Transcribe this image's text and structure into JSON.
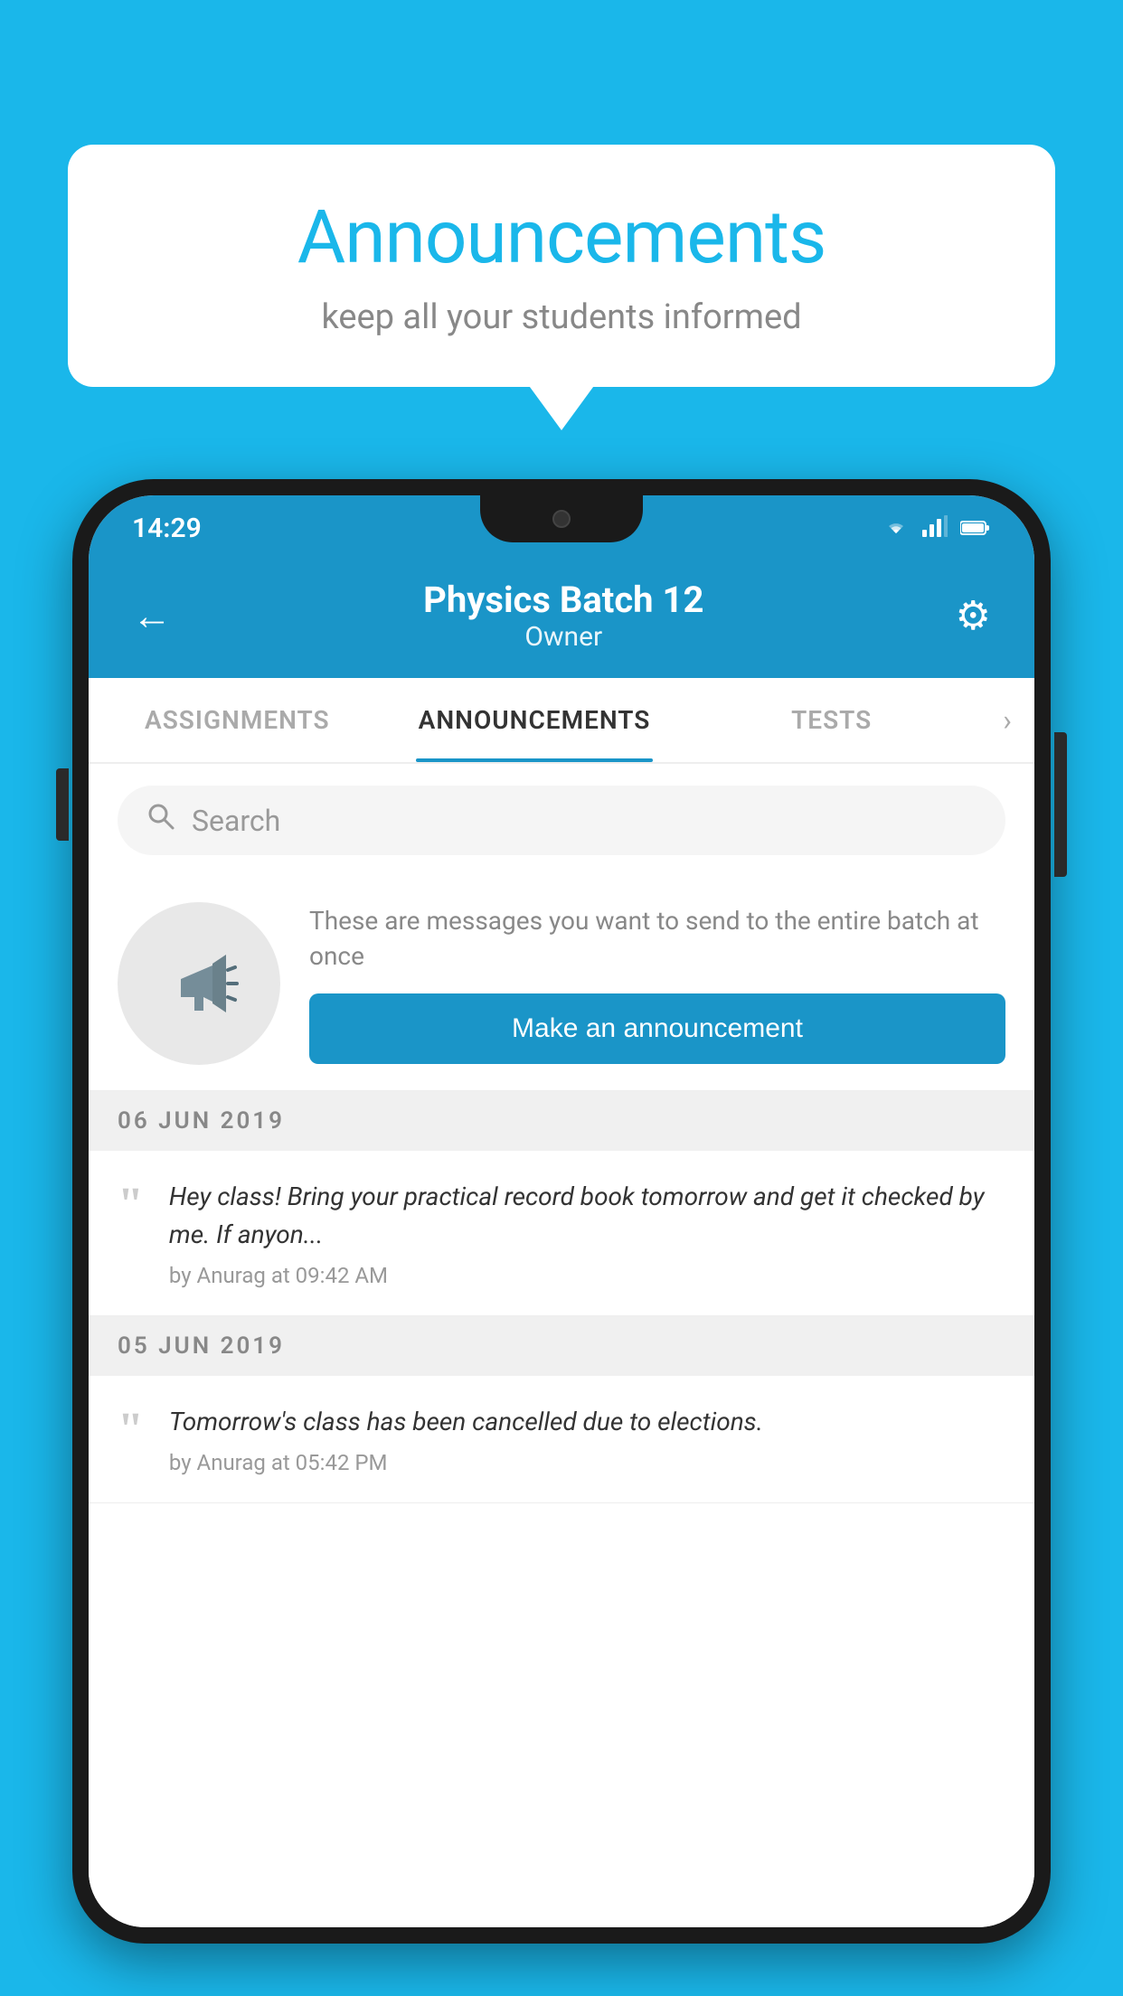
{
  "background_color": "#1ab7ea",
  "speech_bubble": {
    "title": "Announcements",
    "subtitle": "keep all your students informed"
  },
  "status_bar": {
    "time": "14:29",
    "wifi_icon": "▼",
    "signal_icon": "◀",
    "battery_icon": "▮"
  },
  "app_header": {
    "back_label": "←",
    "title": "Physics Batch 12",
    "subtitle": "Owner",
    "settings_icon": "⚙"
  },
  "tabs": [
    {
      "label": "ASSIGNMENTS",
      "active": false
    },
    {
      "label": "ANNOUNCEMENTS",
      "active": true
    },
    {
      "label": "TESTS",
      "active": false
    }
  ],
  "search": {
    "placeholder": "Search"
  },
  "empty_state": {
    "description": "These are messages you want to send to the entire batch at once",
    "button_label": "Make an announcement"
  },
  "date_groups": [
    {
      "date": "06  JUN  2019",
      "messages": [
        {
          "text": "Hey class! Bring your practical record book tomorrow and get it checked by me. If anyon...",
          "meta": "by Anurag at 09:42 AM"
        }
      ]
    },
    {
      "date": "05  JUN  2019",
      "messages": [
        {
          "text": "Tomorrow's class has been cancelled due to elections.",
          "meta": "by Anurag at 05:42 PM"
        }
      ]
    }
  ]
}
